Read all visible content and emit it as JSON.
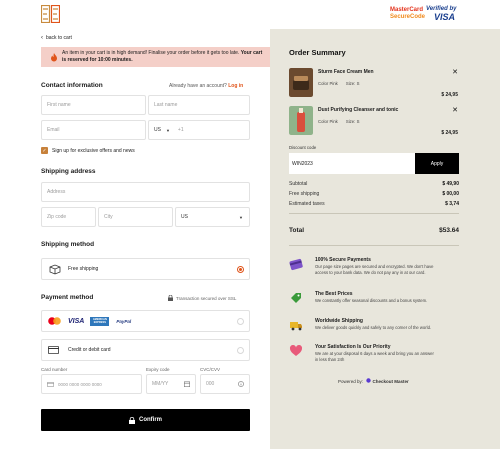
{
  "header": {
    "logo_icon": "brand-monogram-logo",
    "mastercard_line1": "MasterCard",
    "mastercard_line2": "SecureCode",
    "visa_line1": "Verified by",
    "visa_line2": "VISA"
  },
  "nav": {
    "back_label": "back to cart"
  },
  "alert": {
    "text": "An item in your cart is in high demand! Finalise your order before it gets too late.",
    "bold": "Your cart is reserved for 10:00 minutes."
  },
  "contact": {
    "title": "Contact information",
    "account_prompt": "Already have an account?",
    "login_label": "Log in",
    "first_name_placeholder": "First name",
    "last_name_placeholder": "Last name",
    "email_placeholder": "Email",
    "country_code": "US",
    "phone_placeholder": "+1",
    "offers_label": "Sign up for exclusive offers and news"
  },
  "shipping_address": {
    "title": "Shipping address",
    "address_placeholder": "Address",
    "zip_placeholder": "Zip code",
    "city_placeholder": "City",
    "country_value": "US"
  },
  "shipping_method": {
    "title": "Shipping method",
    "option_label": "Free shipping"
  },
  "payment": {
    "title": "Payment method",
    "secured_note": "Transaction secured over SSL",
    "brands": [
      "VISA",
      "AMERICAN EXPRESS",
      "PayPal"
    ],
    "card_option_label": "Credit or debit card",
    "card_number_label": "Card number",
    "card_number_placeholder": "0000  0000  0000  0000",
    "expiry_label": "Expiry code",
    "expiry_placeholder": "MM/YY",
    "cvv_label": "CVC/CVV",
    "cvv_placeholder": "000"
  },
  "confirm_label": "Confirm",
  "summary": {
    "title": "Order Summary",
    "items": [
      {
        "name": "Sturm Face Cream Men",
        "color": "Color Pink",
        "size": "Size: S",
        "price": "$ 24,95"
      },
      {
        "name": "Dust Purifying Cleanser and tonic",
        "color": "Color Pink",
        "size": "Size: S",
        "price": "$ 24,95"
      }
    ],
    "discount_label": "Discount code",
    "discount_value": "WIN2023",
    "apply_label": "Apply",
    "subtotal_label": "Subtotal",
    "subtotal_value": "$ 49,90",
    "shipping_label": "Free shipping",
    "shipping_value": "$ 00,00",
    "tax_label": "Estimated taxes",
    "tax_value": "$ 3,74",
    "total_label": "Total",
    "total_value": "$53.64"
  },
  "features": [
    {
      "icon": "credit-card-icon",
      "title": "100% Secure Payments",
      "desc": "Our page size pages are secured and encrypted. We don't have access to your bank data. We do not pay any in at our card."
    },
    {
      "icon": "price-tag-icon",
      "title": "The Best Prices",
      "desc": "We constantly offer seasonal discounts and a bonus system."
    },
    {
      "icon": "delivery-truck-icon",
      "title": "Worldwide Shipping",
      "desc": "We deliver goods quickly and safely to any corner of the world."
    },
    {
      "icon": "satisfaction-heart-icon",
      "title": "Your Satisfaction Is Our Priority",
      "desc": "We are at your disposal 6 days a week and bring you an answer in less than 24h"
    }
  ],
  "powered": {
    "prefix": "Powered by:",
    "brand": "Checkout Master"
  },
  "colors": {
    "accent": "#e0541a",
    "alert_bg": "#f4cfc8",
    "summary_bg": "#e8e6dc"
  }
}
